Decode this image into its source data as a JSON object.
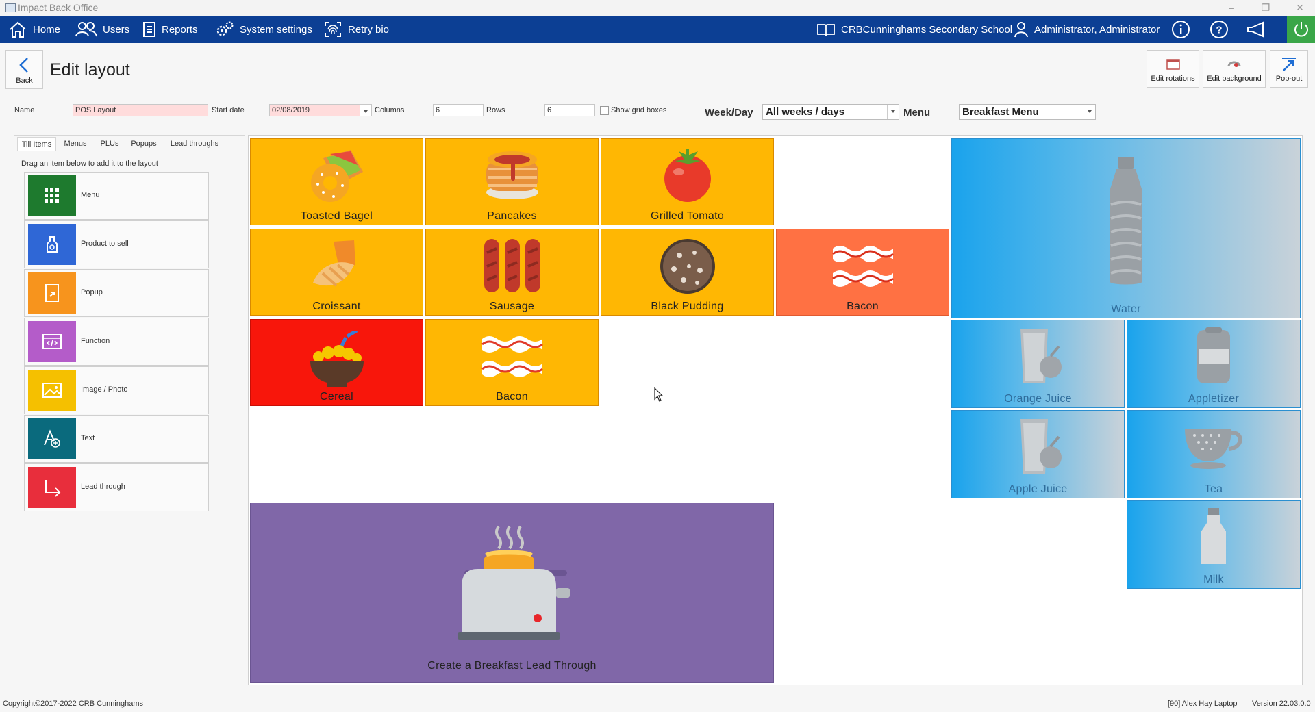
{
  "window": {
    "title": "Impact Back Office"
  },
  "nav": {
    "home": "Home",
    "users": "Users",
    "reports": "Reports",
    "system_settings": "System settings",
    "retry_bio": "Retry bio",
    "school": "CRBCunninghams Secondary School",
    "user": "Administrator, Administrator"
  },
  "header": {
    "back": "Back",
    "title": "Edit layout",
    "edit_rotations": "Edit rotations",
    "edit_background": "Edit background",
    "pop_out": "Pop-out"
  },
  "form": {
    "name_label": "Name",
    "name_value": "POS Layout",
    "start_date_label": "Start date",
    "start_date_value": "02/08/2019",
    "columns_label": "Columns",
    "columns_value": "6",
    "rows_label": "Rows",
    "rows_value": "6",
    "show_grid_label": "Show grid boxes",
    "weekday_label": "Week/Day",
    "weekday_value": "All weeks / days",
    "menu_label": "Menu",
    "menu_value": "Breakfast Menu"
  },
  "palette": {
    "tabs": [
      "Till Items",
      "Menus",
      "PLUs",
      "Popups",
      "Lead throughs"
    ],
    "hint": "Drag an item below to add it to the layout",
    "items": [
      {
        "label": "Menu",
        "color": "#1e7a2e",
        "icon": "grid-icon"
      },
      {
        "label": "Product to sell",
        "color": "#2f67d6",
        "icon": "bottle-icon"
      },
      {
        "label": "Popup",
        "color": "#f7941d",
        "icon": "popup-icon"
      },
      {
        "label": "Function",
        "color": "#b45cc9",
        "icon": "code-icon"
      },
      {
        "label": "Image / Photo",
        "color": "#f5c000",
        "icon": "image-icon"
      },
      {
        "label": "Text",
        "color": "#0a6a7d",
        "icon": "text-add-icon"
      },
      {
        "label": "Lead through",
        "color": "#e82e3c",
        "icon": "arrow-down-right-icon"
      }
    ]
  },
  "tiles": {
    "toasted_bagel": "Toasted Bagel",
    "pancakes": "Pancakes",
    "grilled_tomato": "Grilled Tomato",
    "croissant": "Croissant",
    "sausage": "Sausage",
    "black_pudding": "Black Pudding",
    "bacon_orange": "Bacon",
    "cereal": "Cereal",
    "bacon_yellow": "Bacon",
    "water": "Water",
    "orange_juice": "Orange Juice",
    "appletizer": "Appletizer",
    "apple_juice": "Apple Juice",
    "tea": "Tea",
    "milk": "Milk",
    "lead_through": "Create a Breakfast Lead Through"
  },
  "colors": {
    "nav": "#0c3f94",
    "food_tile": "#ffb703",
    "bacon_tile": "#ff7143",
    "cereal_tile": "#f8160b",
    "lead_tile": "#8067a8",
    "drink_tile": "#1aa3ec"
  },
  "status": {
    "copyright": "Copyright©2017-2022 CRB Cunninghams",
    "device": "[90] Alex Hay Laptop",
    "version": "Version 22.03.0.0"
  }
}
